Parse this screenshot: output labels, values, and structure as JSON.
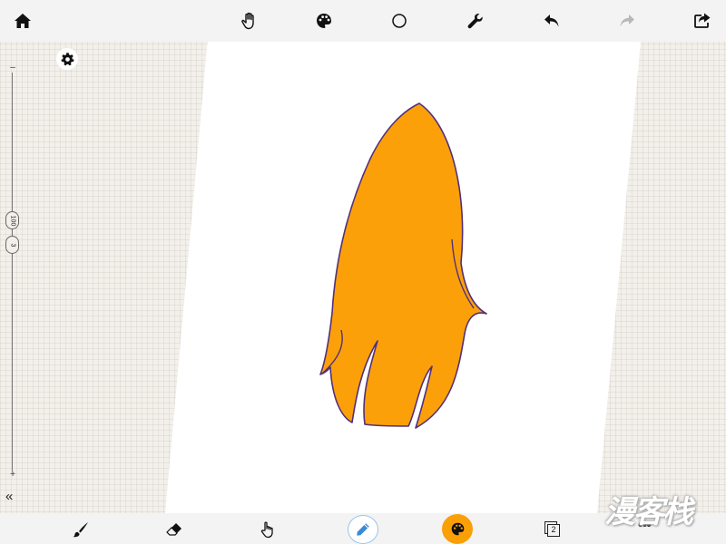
{
  "app": {
    "watermark_text": "漫客栈",
    "colors": {
      "canvas_background": "#f3efea",
      "toolbar_background": "#f3f3f3",
      "paper": "#ffffff",
      "current_color": "#fa9f06",
      "drawing_fill": "#fca00a",
      "drawing_stroke": "#52307a",
      "accent_blue": "#3b8ad8"
    }
  },
  "top_toolbar": {
    "items": [
      {
        "name": "home",
        "icon": "home-icon"
      },
      {
        "name": "move",
        "icon": "hand-icon"
      },
      {
        "name": "palette",
        "icon": "palette-icon"
      },
      {
        "name": "shape",
        "icon": "circle-icon"
      },
      {
        "name": "tools",
        "icon": "wrench-icon"
      },
      {
        "name": "undo",
        "icon": "undo-icon"
      },
      {
        "name": "redo",
        "icon": "redo-icon",
        "enabled": false
      },
      {
        "name": "share",
        "icon": "share-icon"
      }
    ]
  },
  "left_panel": {
    "settings_icon": "gear-icon",
    "slider_minus": "–",
    "slider_plus": "+",
    "opacity_value": "100",
    "size_value": "3",
    "collapse_label": "«"
  },
  "bottom_toolbar": {
    "items": [
      {
        "name": "brush",
        "icon": "brush-icon"
      },
      {
        "name": "eraser",
        "icon": "eraser-icon"
      },
      {
        "name": "touch",
        "icon": "pointer-hand-icon"
      },
      {
        "name": "pen",
        "icon": "pencil-icon",
        "selected": true
      },
      {
        "name": "color",
        "icon": "palette-icon"
      },
      {
        "name": "layers",
        "icon": "layers-icon"
      },
      {
        "name": "more",
        "icon": "more-icon"
      }
    ],
    "layers_count": "2",
    "more_label": "•••"
  }
}
